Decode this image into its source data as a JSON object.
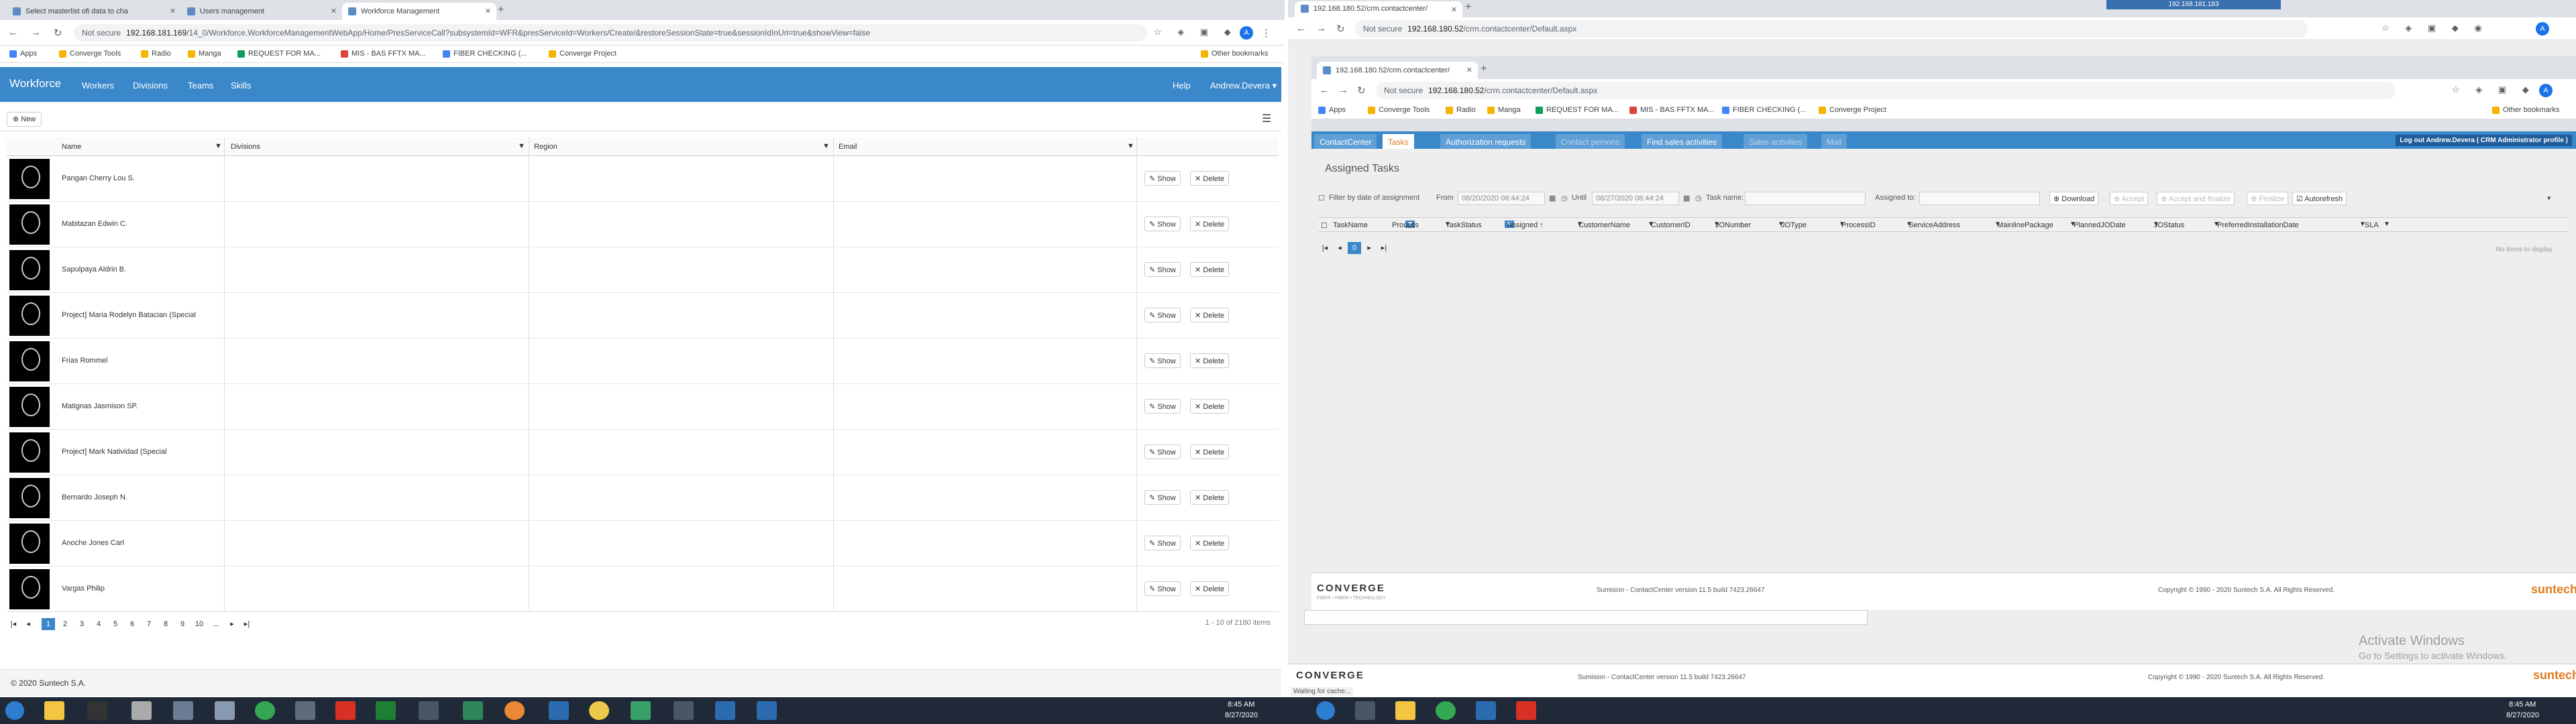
{
  "left": {
    "tabs": [
      {
        "label": "Select masterlist ofi data to cha"
      },
      {
        "label": "Users management"
      },
      {
        "label": "Workforce Management"
      }
    ],
    "url_prefix": "Not secure",
    "url_host": "192.168.181.169",
    "url_path": "/14_0/Workforce.WorkforceManagementWebApp/Home/PresServiceCall?subsystemId=WFR&presServiceId=Workers/Create/&restoreSessionState=true&sessionIdInUrl=true&showView=false",
    "bookmarks": [
      "Apps",
      "Converge Tools",
      "Radio",
      "Manga",
      "REQUEST FOR MA...",
      "MIS - BAS FFTX MA...",
      "FIBER CHECKING (...",
      "Converge Project"
    ],
    "other_bookmarks": "Other bookmarks",
    "nav": {
      "brand": "Workforce",
      "items": [
        "Workers",
        "Divisions",
        "Teams",
        "Skills"
      ],
      "help": "Help",
      "user": "Andrew.Devera ▾"
    },
    "new_label": "New",
    "columns": [
      "Name",
      "Divisions",
      "Region",
      "Email"
    ],
    "rows": [
      "Pangan Cherry Lou S.",
      "Mabitazan Edwin C.",
      "Sapulpaya Aldrin B.",
      "Project] Maria Rodelyn Batacian (Special",
      "Frias Rommel",
      "Matignas Jasmison SP.",
      "Project] Mark Natividad (Special",
      "Bernardo Joseph N.",
      "Anoche Jones Carl",
      "Vargas Philip"
    ],
    "show_label": "Show",
    "delete_label": "Delete",
    "pages": [
      "1",
      "2",
      "3",
      "4",
      "5",
      "6",
      "7",
      "8",
      "9",
      "10",
      "..."
    ],
    "page_info": "1 - 10 of 2180 items",
    "footer": "© 2020 Suntech S.A."
  },
  "right": {
    "outer_tab": "192.168.180.52/crm.contactcenter/",
    "inner_tab": "192.168.180.52/crm.contactcenter/",
    "url_prefix": "Not secure",
    "url_host": "192.168.180.52",
    "url_path": "/crm.contactcenter/Default.aspx",
    "outer_status": "192.168.181.183",
    "bookmarks": [
      "Apps",
      "Converge Tools",
      "Radio",
      "Manga",
      "REQUEST FOR MA...",
      "MIS - BAS FFTX MA...",
      "FIBER CHECKING (...",
      "Converge Project"
    ],
    "other_bookmarks": "Other bookmarks",
    "tabs": [
      "ContactCenter",
      "Tasks",
      "Authorization requests",
      "Contact persons",
      "Find sales activities",
      "Sales activities",
      "Mail"
    ],
    "logout": "Log out Andrew.Devera ( CRM Administrator profile )",
    "title": "Assigned Tasks",
    "filter_label": "Filter by date of assignment",
    "from_label": "From",
    "from_value": "08/20/2020 08:44:24",
    "until_label": "Until",
    "until_value": "08/27/2020 08:44:24",
    "task_name_label": "Task name:",
    "assigned_to_label": "Assigned to:",
    "download": "Download",
    "accept": "Accept",
    "accept_finalize": "Accept and finalize",
    "finalize": "Finalize",
    "autorefresh": "Autorefresh",
    "columns": [
      "TaskName",
      "Process",
      "TaskStatus",
      "Assigned ↑",
      "CustomerName",
      "CustomerID",
      "JONumber",
      "JOType",
      "ProcessID",
      "ServiceAddress",
      "MainlinePackage",
      "PlannedJODate",
      "JOStatus",
      "PreferredInstallationDate",
      "SLA"
    ],
    "page_current": "0",
    "empty": "No items to display",
    "footer_version": "Sumision - ContactCenter version 11.5 build 7423.26647",
    "footer_copy": "Copyright © 1990 - 2020 Suntech S.A. All Rights Reserved.",
    "footer_version2": "Sumision - ContactCenter version 11.5 build 7423.26647",
    "footer_copy2": "Copyright © 1990 - 2020 Suntech S.A. All Rights Reserved.",
    "brand": "CONVERGE",
    "brand_sub": "FIBER • FIBER • TECHNOLOGY",
    "suntech": "suntech",
    "status": "Waiting for cache..."
  },
  "activate": {
    "title": "Activate Windows",
    "subtitle": "Go to Settings to activate Windows."
  },
  "clock": {
    "time": "8:45 AM",
    "date": "8/27/2020"
  }
}
